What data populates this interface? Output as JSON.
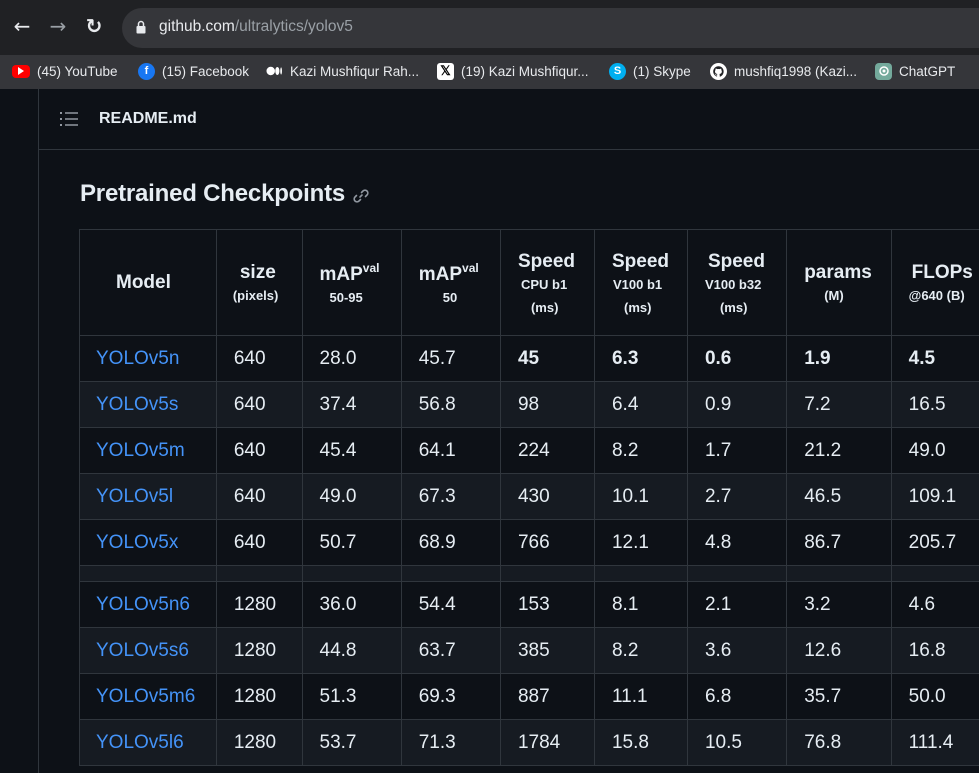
{
  "browser": {
    "url_host": "github.com",
    "url_path": "/ultralytics/yolov5",
    "nav": {
      "back": "←",
      "forward": "→",
      "reload": "↻"
    }
  },
  "bookmarks": [
    {
      "label": "(45) YouTube",
      "icon": "youtube-icon",
      "color": "#ff0000"
    },
    {
      "label": "(15) Facebook",
      "icon": "facebook-icon",
      "color": "#1877f2"
    },
    {
      "label": "Kazi Mushfiqur Rah...",
      "icon": "medium-icon",
      "color": "#ffffff"
    },
    {
      "label": "(19) Kazi Mushfiqur...",
      "icon": "x-icon",
      "color": "#000000"
    },
    {
      "label": "(1) Skype",
      "icon": "skype-icon",
      "color": "#00aff0"
    },
    {
      "label": "mushfiq1998 (Kazi...",
      "icon": "github-icon",
      "color": "#ffffff"
    },
    {
      "label": "ChatGPT",
      "icon": "chatgpt-icon",
      "color": "#74aa9c"
    }
  ],
  "readme": {
    "file_name": "README.md",
    "section_title": "Pretrained Checkpoints"
  },
  "table": {
    "headers": {
      "model": "Model",
      "size": "size",
      "size_unit": "(pixels)",
      "map1": "mAP",
      "map1_sup": "val",
      "map1_sub": "50-95",
      "map2": "mAP",
      "map2_sup": "val",
      "map2_sub": "50",
      "speed_cpu": "Speed",
      "speed_cpu_sub": "CPU b1",
      "speed_cpu_unit": "(ms)",
      "speed_v100": "Speed",
      "speed_v100_sub": "V100 b1",
      "speed_v100_unit": "(ms)",
      "speed_v100b32": "Speed",
      "speed_v100b32_sub": "V100 b32",
      "speed_v100b32_unit": "(ms)",
      "params": "params",
      "params_unit": "(M)",
      "flops": "FLOPs",
      "flops_unit": "@640 (B)"
    },
    "rows": [
      [
        "YOLOv5n",
        "640",
        "28.0",
        "45.7",
        "45",
        "6.3",
        "0.6",
        "1.9",
        "4.5"
      ],
      [
        "YOLOv5s",
        "640",
        "37.4",
        "56.8",
        "98",
        "6.4",
        "0.9",
        "7.2",
        "16.5"
      ],
      [
        "YOLOv5m",
        "640",
        "45.4",
        "64.1",
        "224",
        "8.2",
        "1.7",
        "21.2",
        "49.0"
      ],
      [
        "YOLOv5l",
        "640",
        "49.0",
        "67.3",
        "430",
        "10.1",
        "2.7",
        "46.5",
        "109.1"
      ],
      [
        "YOLOv5x",
        "640",
        "50.7",
        "68.9",
        "766",
        "12.1",
        "4.8",
        "86.7",
        "205.7"
      ],
      [
        "YOLOv5n6",
        "1280",
        "36.0",
        "54.4",
        "153",
        "8.1",
        "2.1",
        "3.2",
        "4.6"
      ],
      [
        "YOLOv5s6",
        "1280",
        "44.8",
        "63.7",
        "385",
        "8.2",
        "3.6",
        "12.6",
        "16.8"
      ],
      [
        "YOLOv5m6",
        "1280",
        "51.3",
        "69.3",
        "887",
        "11.1",
        "6.8",
        "35.7",
        "50.0"
      ],
      [
        "YOLOv5l6",
        "1280",
        "53.7",
        "71.3",
        "1784",
        "15.8",
        "10.5",
        "76.8",
        "111.4"
      ]
    ]
  }
}
